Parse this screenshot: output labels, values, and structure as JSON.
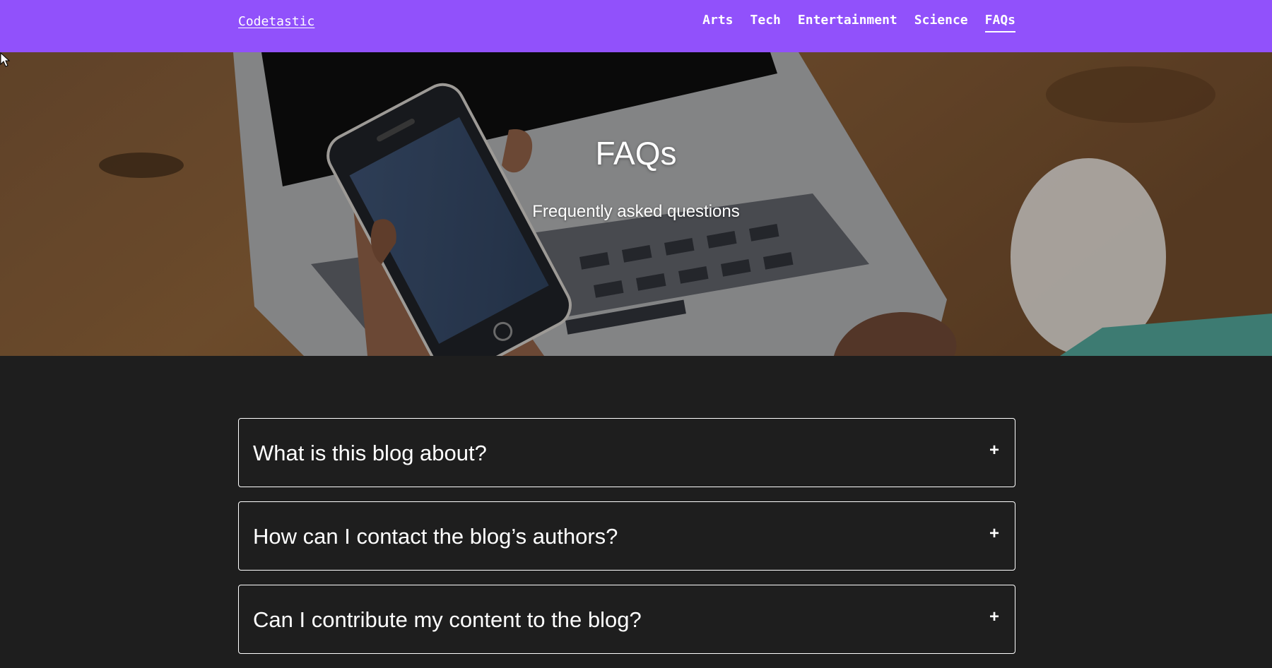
{
  "brand": {
    "name": "Codetastic"
  },
  "nav": {
    "items": [
      {
        "label": "Arts"
      },
      {
        "label": "Tech"
      },
      {
        "label": "Entertainment"
      },
      {
        "label": "Science"
      },
      {
        "label": "FAQs"
      }
    ],
    "active": "FAQs"
  },
  "hero": {
    "title": "FAQs",
    "subtitle": "Frequently asked questions"
  },
  "faqs": [
    {
      "question": "What is this blog about?",
      "toggle": "+"
    },
    {
      "question": "How can I contact the blog’s authors?",
      "toggle": "+"
    },
    {
      "question": "Can I contribute my content to the blog?",
      "toggle": "+"
    }
  ],
  "colors": {
    "navbar": "#9151fb",
    "background": "#1e1e1e",
    "text": "#ffffff"
  }
}
